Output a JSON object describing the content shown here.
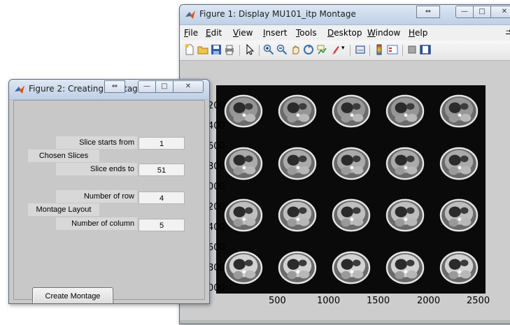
{
  "figure1": {
    "title": "Figure 1: Display MU101_itp Montage",
    "menu": [
      "File",
      "Edit",
      "View",
      "Insert",
      "Tools",
      "Desktop",
      "Window",
      "Help"
    ],
    "overflow_glyph": "→",
    "toolbar_icons": [
      "new-figure-icon",
      "open-file-icon",
      "save-icon",
      "print-icon",
      "pointer-icon",
      "zoom-in-icon",
      "zoom-out-icon",
      "pan-icon",
      "rotate-3d-icon",
      "data-cursor-icon",
      "brush-icon",
      "link-icon",
      "colorbar-icon",
      "legend-icon",
      "hide-plot-tools-icon",
      "show-plot-tools-icon"
    ],
    "montage": {
      "rows": 4,
      "columns": 5
    },
    "y_ticks": [
      "200",
      "400",
      "600",
      "800",
      "000",
      "200",
      "400",
      "600",
      "800",
      "000"
    ],
    "x_ticks": [
      "500",
      "1000",
      "1500",
      "2000",
      "2500"
    ]
  },
  "figure2": {
    "title": "Figure 2: Creating Montage",
    "chosen_slices_label": "Chosen Slices",
    "slice_start_label": "Slice starts from",
    "slice_start_value": "1",
    "slice_end_label": "Slice ends to",
    "slice_end_value": "51",
    "montage_layout_label": "Montage Layout",
    "rows_label": "Number of row",
    "rows_value": "4",
    "columns_label": "Number of column",
    "columns_value": "5",
    "create_button": "Create Montage"
  },
  "window_buttons": {
    "restore": "⇔",
    "minimize": "—",
    "maximize": "□",
    "close": "✕"
  }
}
